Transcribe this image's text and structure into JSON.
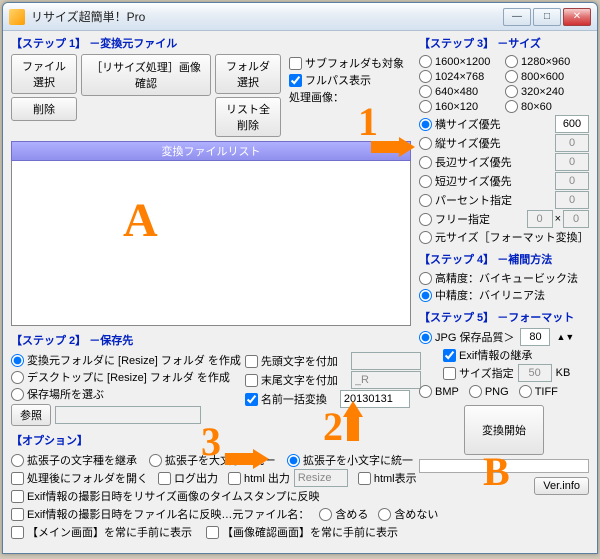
{
  "window": {
    "title": "リサイズ超簡単！Pro"
  },
  "step1": {
    "title": "【ステップ 1】 －変換元ファイル",
    "file_select": "ファイル選択",
    "folder_select": "フォルダ選択",
    "delete": "削除",
    "resize_preview": "［リサイズ処理］画像確認",
    "delete_all": "リスト全削除",
    "subfolder": "サブフォルダも対象",
    "fullpath": "フルパス表示",
    "proc_image": "処理画像：",
    "list_header": "変換ファイルリスト"
  },
  "step2": {
    "title": "【ステップ 2】 －保存先",
    "r1": "変換元フォルダに [Resize] フォルダ を作成",
    "r2": "デスクトップに [Resize] フォルダ を作成",
    "r3": "保存場所を選ぶ",
    "browse": "参照",
    "prefix": "先頭文字を付加",
    "suffix": "末尾文字を付加",
    "rename": "名前一括変換",
    "prefix_val": "",
    "suffix_val": "_R",
    "rename_val": "20130131"
  },
  "options": {
    "title": "【オプション】",
    "ext_inherit": "拡張子の文字種を継承",
    "ext_upper": "拡張子を大文字に統一",
    "ext_lower": "拡張子を小文字に統一",
    "no_folder": "処理後にフォルダを開く",
    "log_out": "ログ出力",
    "html_out": "html 出力",
    "html_out_name": "Resize",
    "html_show": "html表示",
    "exif_ts": "Exif情報の撮影日時をリサイズ画像のタイムスタンプに反映",
    "exif_fn": "Exif情報の撮影日時をファイル名に反映…元ファイル名：",
    "include": "含める",
    "exclude": "含めない",
    "main_always": "【メイン画面】を常に手前に表示",
    "preview_always": "【画像確認画面】を常に手前に表示"
  },
  "step3": {
    "title": "【ステップ 3】 －サイズ",
    "sizes": [
      "1600×1200",
      "1280×960",
      "1024×768",
      "800×600",
      "640×480",
      "320×240",
      "160×120",
      "80×60"
    ],
    "yoko": "横サイズ優先",
    "yoko_val": "600",
    "tate": "縦サイズ優先",
    "tate_val": "0",
    "long": "長辺サイズ優先",
    "long_val": "0",
    "short": "短辺サイズ優先",
    "short_val": "0",
    "percent": "パーセント指定",
    "percent_val": "0",
    "free": "フリー指定",
    "free_w": "0",
    "free_x": "×",
    "free_h": "0",
    "original": "元サイズ［フォーマット変換］"
  },
  "step4": {
    "title": "【ステップ 4】 －補間方法",
    "hi": "高精度：バイキュービック法",
    "mid": "中精度：バイリニア法"
  },
  "step5": {
    "title": "【ステップ 5】 －フォーマット",
    "jpg": "JPG  保存品質＞",
    "jpg_q": "80",
    "exif_inherit": "Exif情報の継承",
    "size_spec": "サイズ指定",
    "size_val": "50",
    "kb": "KB",
    "bmp": "BMP",
    "png": "PNG",
    "tiff": "TIFF",
    "start": "変換開始",
    "ver": "Ver.info"
  },
  "annot": {
    "a": "A",
    "b": "B",
    "n1": "1",
    "n2": "2",
    "n3": "3"
  }
}
